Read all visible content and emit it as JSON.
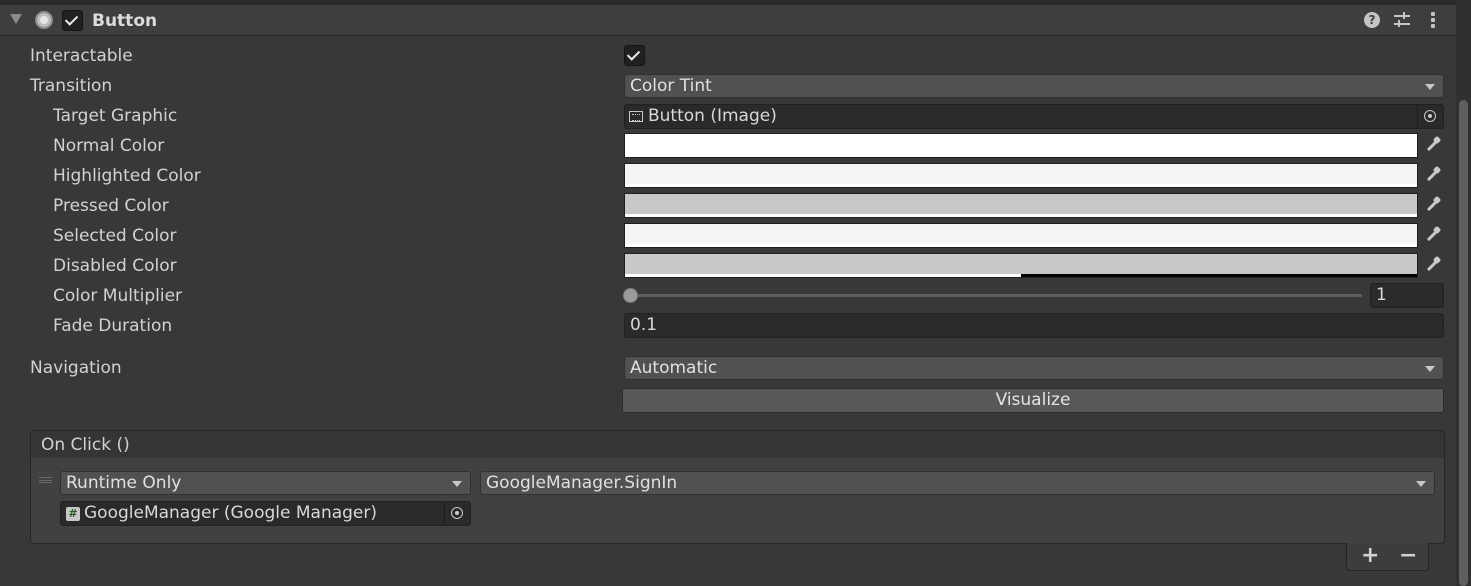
{
  "component": {
    "title": "Button",
    "enabled": true,
    "header_icons": [
      "help-icon",
      "presets-icon",
      "kebab-menu-icon"
    ]
  },
  "fields": {
    "interactable": {
      "label": "Interactable",
      "checked": true
    },
    "transition": {
      "label": "Transition",
      "value": "Color Tint"
    },
    "target_graphic": {
      "label": "Target Graphic",
      "value": "Button (Image)"
    },
    "normal_color": {
      "label": "Normal Color",
      "color": "#ffffff",
      "alpha": 1.0
    },
    "highlighted_color": {
      "label": "Highlighted Color",
      "color": "#f5f5f5",
      "alpha": 1.0
    },
    "pressed_color": {
      "label": "Pressed Color",
      "color": "#c8c8c8",
      "alpha": 1.0
    },
    "selected_color": {
      "label": "Selected Color",
      "color": "#f5f5f5",
      "alpha": 1.0
    },
    "disabled_color": {
      "label": "Disabled Color",
      "color": "#c8c8c8",
      "alpha": 0.5
    },
    "color_multiplier": {
      "label": "Color Multiplier",
      "value": "1",
      "slider_fraction": 0.0
    },
    "fade_duration": {
      "label": "Fade Duration",
      "value": "0.1"
    },
    "navigation": {
      "label": "Navigation",
      "value": "Automatic"
    },
    "visualize": {
      "label": "Visualize"
    }
  },
  "on_click": {
    "title": "On Click ()",
    "entries": [
      {
        "call_state": "Runtime Only",
        "function": "GoogleManager.SignIn",
        "target": "GoogleManager (Google Manager)"
      }
    ],
    "add_label": "+",
    "remove_label": "−"
  }
}
